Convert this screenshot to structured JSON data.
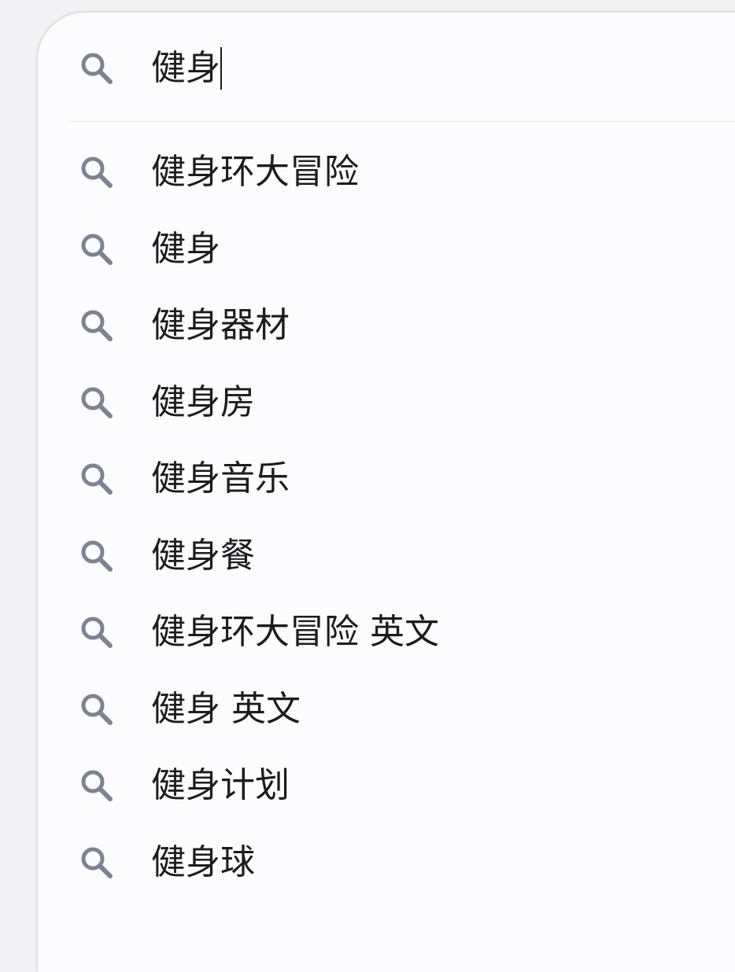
{
  "search": {
    "query": "健身",
    "icon": "search-icon"
  },
  "suggestions": [
    {
      "label": "健身环大冒险",
      "icon": "search-icon"
    },
    {
      "label": "健身",
      "icon": "search-icon"
    },
    {
      "label": "健身器材",
      "icon": "search-icon"
    },
    {
      "label": "健身房",
      "icon": "search-icon"
    },
    {
      "label": "健身音乐",
      "icon": "search-icon"
    },
    {
      "label": "健身餐",
      "icon": "search-icon"
    },
    {
      "label": "健身环大冒险 英文",
      "icon": "search-icon"
    },
    {
      "label": "健身 英文",
      "icon": "search-icon"
    },
    {
      "label": "健身计划",
      "icon": "search-icon"
    },
    {
      "label": "健身球",
      "icon": "search-icon"
    }
  ],
  "colors": {
    "icon": "#7b8493",
    "text": "#1c1b20",
    "panel": "#fcfbfd"
  }
}
